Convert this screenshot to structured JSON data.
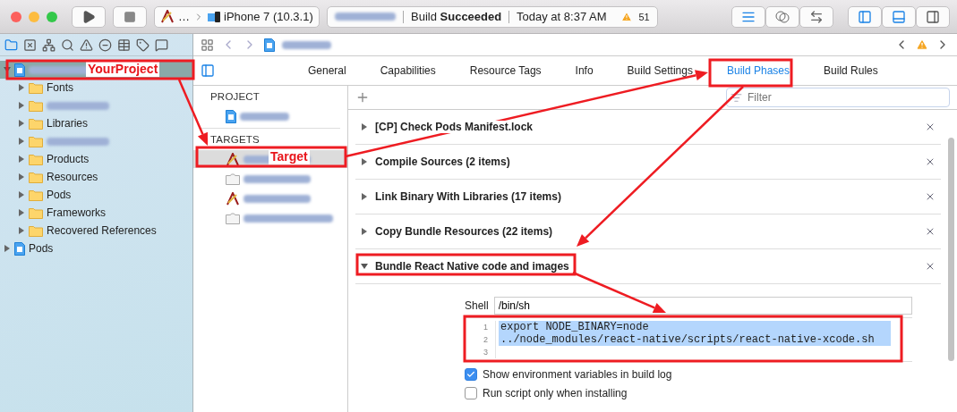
{
  "toolbar": {
    "scheme": "…",
    "device": "iPhone 7 (10.3.1)",
    "status": "Build **Succeeded**",
    "time": "Today at 8:37 AM",
    "warnings": "51",
    "panels": [
      {
        "selected": true
      },
      {
        "selected": true
      },
      {
        "selected": false
      }
    ]
  },
  "navigator": {
    "tree": [
      {
        "kind": "project",
        "redacted": true,
        "selected": true,
        "expanded": true,
        "children": [
          {
            "kind": "folder",
            "label": "Fonts",
            "expanded": false
          },
          {
            "kind": "folder",
            "redacted": true,
            "expanded": false
          },
          {
            "kind": "folder",
            "label": "Libraries",
            "expanded": false
          },
          {
            "kind": "folder",
            "redacted": true,
            "expanded": false
          },
          {
            "kind": "folder",
            "label": "Products",
            "expanded": false
          },
          {
            "kind": "folder",
            "label": "Resources",
            "expanded": false
          },
          {
            "kind": "folder",
            "label": "Pods",
            "expanded": false
          },
          {
            "kind": "folder",
            "label": "Frameworks",
            "expanded": false
          },
          {
            "kind": "folder",
            "label": "Recovered References",
            "expanded": false
          }
        ]
      },
      {
        "kind": "project",
        "label": "Pods",
        "selected": false,
        "expanded": false
      }
    ]
  },
  "editor": {
    "tabs": [
      {
        "label": "General",
        "selected": false
      },
      {
        "label": "Capabilities",
        "selected": false
      },
      {
        "label": "Resource Tags",
        "selected": false
      },
      {
        "label": "Info",
        "selected": false
      },
      {
        "label": "Build Settings",
        "selected": false
      },
      {
        "label": "Build Phases",
        "selected": true
      },
      {
        "label": "Build Rules",
        "selected": false
      }
    ],
    "project_heading": "PROJECT",
    "projects": [
      {
        "kind": "project",
        "redacted": true,
        "selected": false
      }
    ],
    "targets_heading": "TARGETS",
    "targets": [
      {
        "kind": "app",
        "redacted": true,
        "selected": true
      },
      {
        "kind": "bundle",
        "redacted": true,
        "selected": false
      },
      {
        "kind": "app",
        "redacted": true,
        "selected": false
      },
      {
        "kind": "bundle",
        "redacted": true,
        "selected": false
      }
    ],
    "filter": {
      "placeholder": "Filter"
    },
    "phases": [
      {
        "title": "[CP] Check Pods Manifest.lock",
        "expanded": false
      },
      {
        "title": "Compile Sources (2 items)",
        "expanded": false
      },
      {
        "title": "Link Binary With Libraries (17 items)",
        "expanded": false
      },
      {
        "title": "Copy Bundle Resources (22 items)",
        "expanded": false
      },
      {
        "title": "Bundle React Native code and images",
        "expanded": true
      }
    ],
    "script": {
      "shell_label": "Shell",
      "shell": "/bin/sh",
      "selected": true,
      "lines": [
        {
          "number": "1",
          "code": "export NODE_BINARY=node"
        },
        {
          "number": "2",
          "code": "../node_modules/react-native/scripts/react-native-xcode.sh"
        },
        {
          "number": "3"
        }
      ],
      "options": [
        {
          "label": "Show environment variables in build log",
          "checked": true
        },
        {
          "label": "Run script only when installing",
          "checked": false
        }
      ]
    }
  },
  "annotations": {
    "project_label": "YourProject",
    "target_label": "Target"
  }
}
